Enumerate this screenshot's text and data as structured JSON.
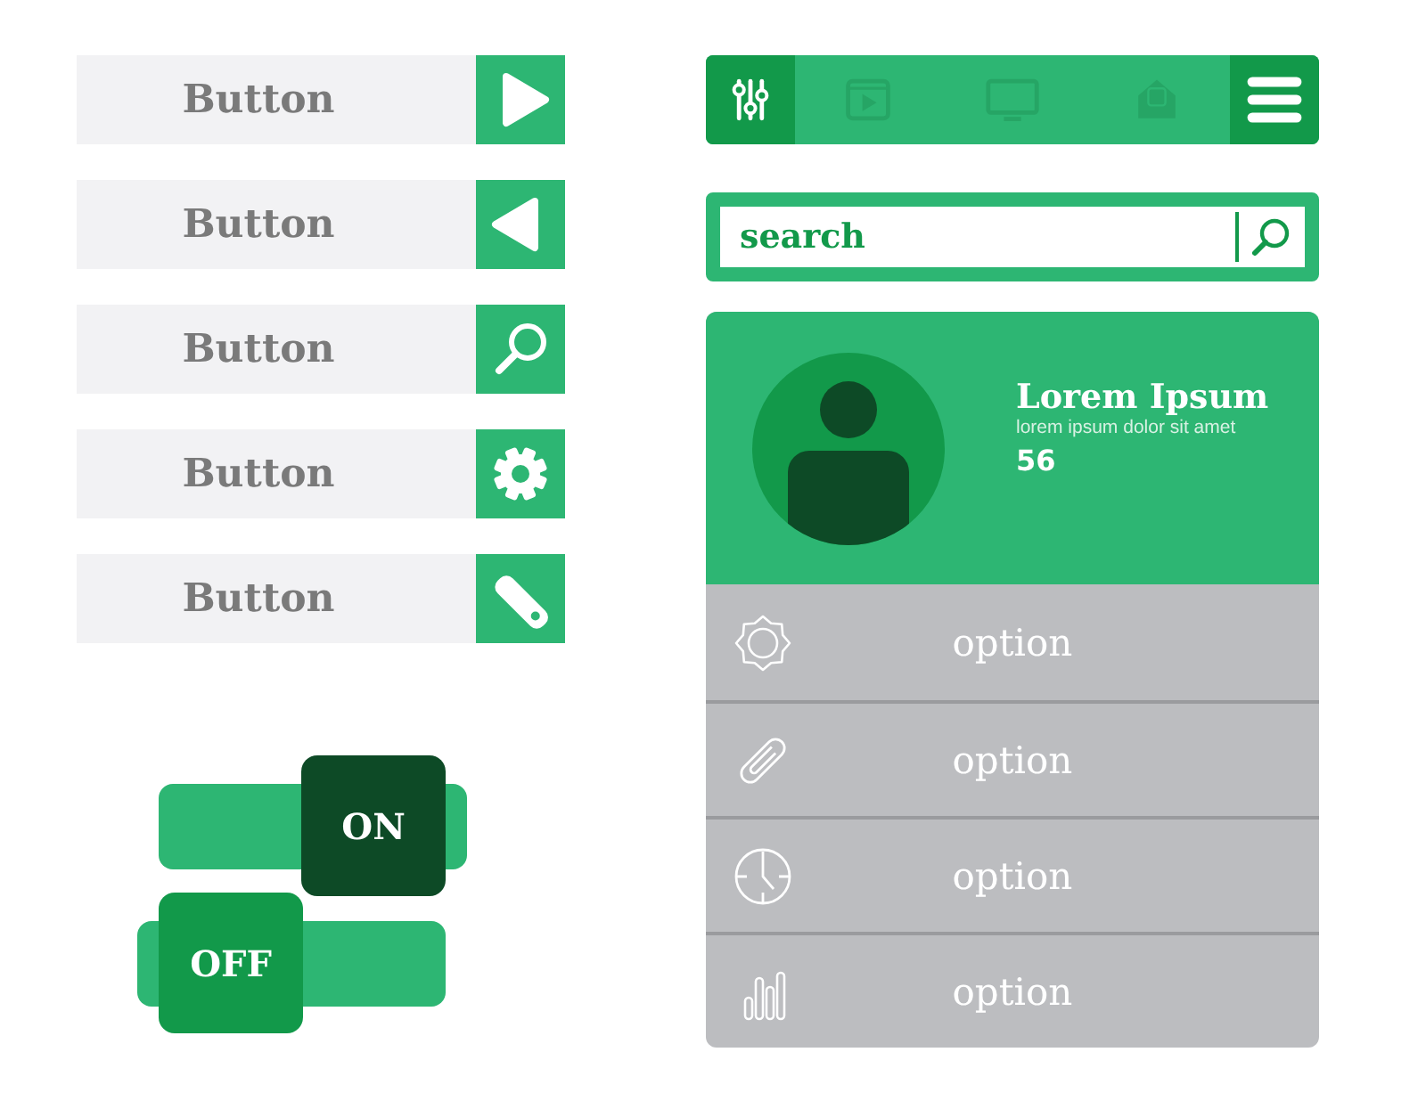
{
  "buttons": [
    {
      "label": "Button",
      "kind": "play"
    },
    {
      "label": "Button",
      "kind": "back"
    },
    {
      "label": "Button",
      "kind": "search"
    },
    {
      "label": "Button",
      "kind": "gear"
    },
    {
      "label": "Button",
      "kind": "tag"
    }
  ],
  "toggles": [
    {
      "label": "ON",
      "on": true
    },
    {
      "label": "OFF",
      "on": false
    }
  ],
  "nav": {
    "tabs": [
      {
        "kind": "sliders",
        "selected": true
      },
      {
        "kind": "video",
        "selected": false
      },
      {
        "kind": "monitor",
        "selected": false
      },
      {
        "kind": "mail",
        "selected": false
      }
    ]
  },
  "search": {
    "placeholder": "search"
  },
  "profile": {
    "name": "Lorem Ipsum",
    "subtitle": "lorem ipsum dolor sit amet",
    "count": "56"
  },
  "options": [
    {
      "label": "option",
      "kind": "gear"
    },
    {
      "label": "option",
      "kind": "clip"
    },
    {
      "label": "option",
      "kind": "clock"
    },
    {
      "label": "option",
      "kind": "chart"
    }
  ]
}
